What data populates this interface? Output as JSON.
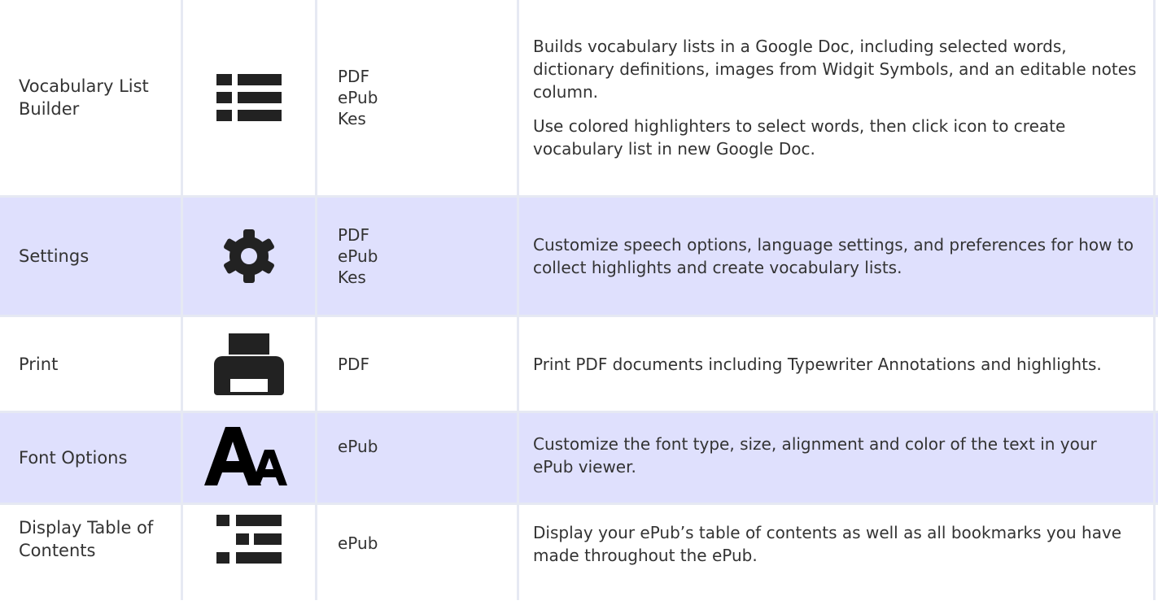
{
  "rows": [
    {
      "name": "Vocabulary List Builder",
      "icon": "list-icon",
      "formats": [
        "PDF",
        "ePub",
        "Kes"
      ],
      "description": [
        "Builds vocabulary lists in a Google Doc, including selected words, dictionary definitions, images from Widgit Symbols, and an editable notes column.",
        "Use colored highlighters to select words, then click icon to create vocabulary list in new Google Doc."
      ]
    },
    {
      "name": "Settings",
      "icon": "gear-icon",
      "formats": [
        "PDF",
        "ePub",
        "Kes"
      ],
      "description": [
        "Customize speech options, language settings, and preferences for how to collect highlights and create vocabulary lists."
      ]
    },
    {
      "name": "Print",
      "icon": "printer-icon",
      "formats": [
        "PDF"
      ],
      "description": [
        "Print PDF documents including Typewriter Annotations and highlights."
      ]
    },
    {
      "name": "Font Options",
      "icon": "font-options-icon",
      "formats": [
        "ePub"
      ],
      "description": [
        "Customize the font type, size, alignment and color of the text in your ePub viewer."
      ]
    },
    {
      "name": "Display Table of Contents",
      "icon": "table-of-contents-icon",
      "formats": [
        "ePub"
      ],
      "description": [
        "Display your ePub’s table of contents as well as all bookmarks you have made throughout the ePub."
      ]
    }
  ],
  "colors": {
    "row_alt": "#dfe0fd",
    "row_plain": "#ffffff",
    "border": "#e6e9f3",
    "icon": "#222222"
  }
}
